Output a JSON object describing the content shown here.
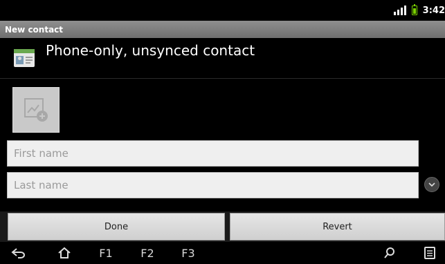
{
  "status_bar": {
    "time": "3:42",
    "icons": [
      "signal-icon",
      "battery-icon"
    ]
  },
  "app_bar": {
    "title": "New contact"
  },
  "account": {
    "label": "Phone-only, unsynced contact",
    "icon": "contact-card-icon"
  },
  "photo": {
    "icon": "add-photo-icon"
  },
  "form": {
    "first_name": {
      "placeholder": "First name",
      "value": ""
    },
    "last_name": {
      "placeholder": "Last name",
      "value": ""
    },
    "expand_icon": "chevron-down-icon"
  },
  "actions": {
    "done_label": "Done",
    "revert_label": "Revert"
  },
  "nav_bar": {
    "f1": "F1",
    "f2": "F2",
    "f3": "F3",
    "icons": [
      "back-icon",
      "home-icon",
      "search-icon",
      "menu-icon"
    ]
  },
  "colors": {
    "background": "#000000",
    "title_bar": "#7f7f7f",
    "battery": "#7ad100",
    "field_bg": "#efefef",
    "button_bg": "#dcdcdc"
  }
}
